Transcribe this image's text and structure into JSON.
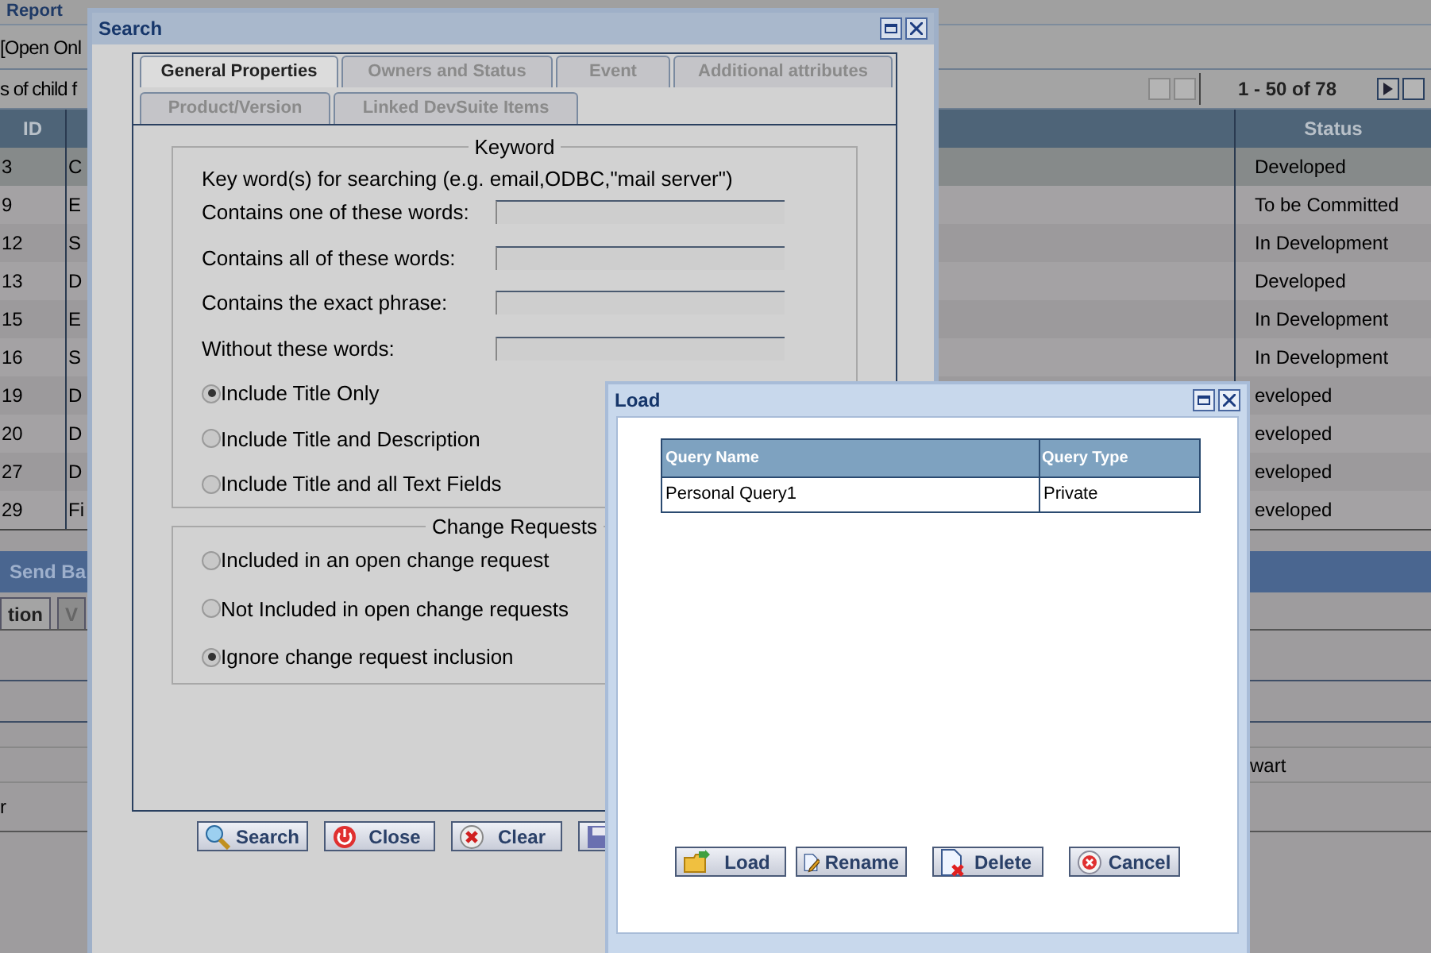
{
  "app": {
    "toolbar": [
      {
        "label": "Report"
      }
    ],
    "filter_text": "[Open Onl",
    "child_text": "s of child f",
    "pager": {
      "range": "1 - 50 of 78"
    },
    "table": {
      "columns": [
        "ID",
        "Status"
      ],
      "rows": [
        {
          "id": "3",
          "title": "C",
          "status": "Developed",
          "selected": true
        },
        {
          "id": "9",
          "title": "E",
          "status": "To be Committed",
          "selected": false
        },
        {
          "id": "12",
          "title": "S",
          "status": "In Development",
          "selected": false
        },
        {
          "id": "13",
          "title": "D",
          "status": "Developed",
          "selected": false
        },
        {
          "id": "15",
          "title": "E",
          "status": "In Development",
          "selected": false
        },
        {
          "id": "16",
          "title": "S",
          "status": "In Development",
          "selected": false
        },
        {
          "id": "19",
          "title": "D",
          "status": "eveloped",
          "selected": false
        },
        {
          "id": "20",
          "title": "D",
          "status": "eveloped",
          "selected": false
        },
        {
          "id": "27",
          "title": "D",
          "status": "eveloped",
          "selected": false
        },
        {
          "id": "29",
          "title": "Fi",
          "status": "eveloped",
          "selected": false
        }
      ]
    },
    "send_back": "Send Ba",
    "tabs": [
      {
        "label": "tion",
        "selected": true
      },
      {
        "label": "V",
        "selected": false
      }
    ],
    "detail_left": "r",
    "detail_right": "wart"
  },
  "search_dialog": {
    "title": "Search",
    "tabs": [
      {
        "label": "General Properties",
        "selected": true
      },
      {
        "label": "Owners and Status",
        "selected": false
      },
      {
        "label": "Event",
        "selected": false
      },
      {
        "label": "Additional attributes",
        "selected": false
      },
      {
        "label": "Product/Version",
        "selected": false
      },
      {
        "label": "Linked DevSuite Items",
        "selected": false
      }
    ],
    "keyword": {
      "legend": "Keyword",
      "hint": "Key word(s) for searching (e.g. email,ODBC,\"mail server\")",
      "fields": [
        {
          "label": "Contains one of these words:"
        },
        {
          "label": "Contains all of these words:"
        },
        {
          "label": "Contains the exact phrase:"
        },
        {
          "label": "Without these words:"
        }
      ],
      "scope": [
        {
          "label": "Include Title Only",
          "checked": true
        },
        {
          "label": "Include Title and Description",
          "checked": false
        },
        {
          "label": "Include Title and all Text Fields",
          "checked": false
        }
      ]
    },
    "change_requests": {
      "legend": "Change Requests",
      "options": [
        {
          "label": "Included in an open change request",
          "checked": false
        },
        {
          "label": "Not Included in open change requests",
          "checked": false
        },
        {
          "label": "Ignore change request inclusion",
          "checked": true
        }
      ]
    },
    "buttons": [
      {
        "kind": "search",
        "label": "Search"
      },
      {
        "kind": "close",
        "label": "Close"
      },
      {
        "kind": "clear",
        "label": "Clear"
      },
      {
        "kind": "save"
      }
    ]
  },
  "load_dialog": {
    "title": "Load",
    "columns": [
      "Query Name",
      "Query Type"
    ],
    "rows": [
      {
        "name": "Personal Query1",
        "type": "Private"
      }
    ],
    "buttons": [
      {
        "kind": "load",
        "label": "Load"
      },
      {
        "kind": "rename",
        "label": "Rename"
      },
      {
        "kind": "delete",
        "label": "Delete"
      },
      {
        "kind": "cancel",
        "label": "Cancel"
      }
    ]
  }
}
